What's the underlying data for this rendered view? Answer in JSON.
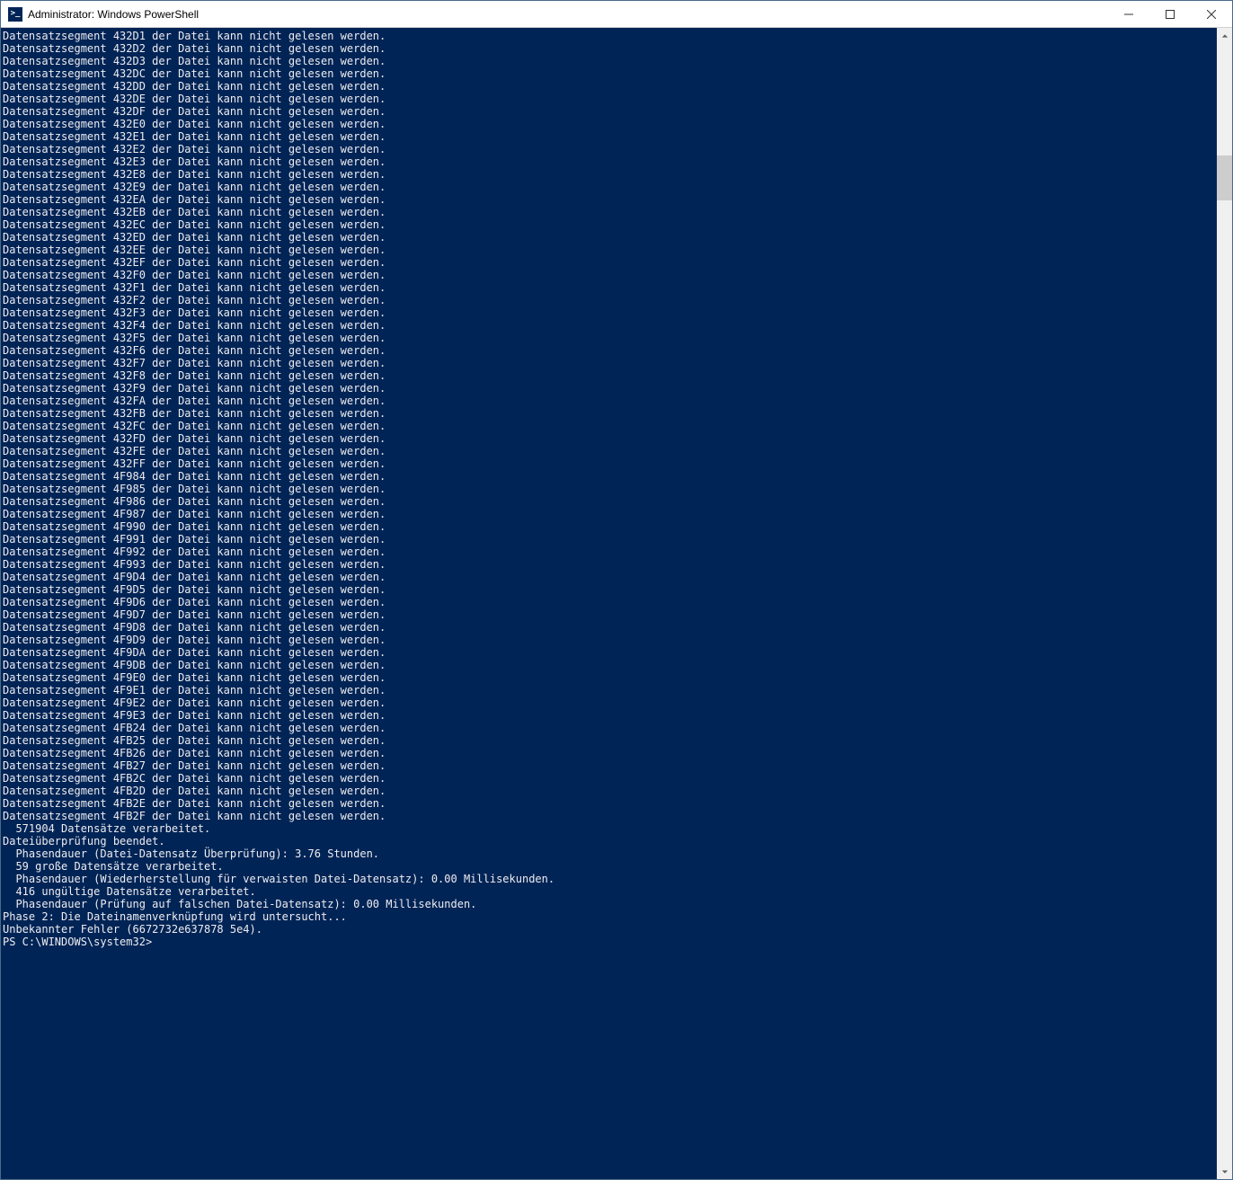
{
  "window": {
    "title": "Administrator: Windows PowerShell",
    "icon_glyph": ">_"
  },
  "scrollbar": {
    "thumb_top_pct": 10,
    "thumb_height_pct": 4
  },
  "terminal": {
    "segment_prefix": "Datensatzsegment ",
    "segment_suffix": " der Datei kann nicht gelesen werden.",
    "segment_ids": [
      "432D1",
      "432D2",
      "432D3",
      "432DC",
      "432DD",
      "432DE",
      "432DF",
      "432E0",
      "432E1",
      "432E2",
      "432E3",
      "432E8",
      "432E9",
      "432EA",
      "432EB",
      "432EC",
      "432ED",
      "432EE",
      "432EF",
      "432F0",
      "432F1",
      "432F2",
      "432F3",
      "432F4",
      "432F5",
      "432F6",
      "432F7",
      "432F8",
      "432F9",
      "432FA",
      "432FB",
      "432FC",
      "432FD",
      "432FE",
      "432FF",
      "4F984",
      "4F985",
      "4F986",
      "4F987",
      "4F990",
      "4F991",
      "4F992",
      "4F993",
      "4F9D4",
      "4F9D5",
      "4F9D6",
      "4F9D7",
      "4F9D8",
      "4F9D9",
      "4F9DA",
      "4F9DB",
      "4F9E0",
      "4F9E1",
      "4F9E2",
      "4F9E3",
      "4FB24",
      "4FB25",
      "4FB26",
      "4FB27",
      "4FB2C",
      "4FB2D",
      "4FB2E",
      "4FB2F"
    ],
    "tail_lines": [
      "  571904 Datensätze verarbeitet.",
      "Dateiüberprüfung beendet.",
      "  Phasendauer (Datei-Datensatz Überprüfung): 3.76 Stunden.",
      "  59 große Datensätze verarbeitet.",
      "  Phasendauer (Wiederherstellung für verwaisten Datei-Datensatz): 0.00 Millisekunden.",
      "  416 ungültige Datensätze verarbeitet.",
      "  Phasendauer (Prüfung auf falschen Datei-Datensatz): 0.00 Millisekunden.",
      "",
      "Phase 2: Die Dateinamenverknüpfung wird untersucht...",
      "Unbekannter Fehler (6672732e637878 5e4).",
      "PS C:\\WINDOWS\\system32>"
    ]
  }
}
